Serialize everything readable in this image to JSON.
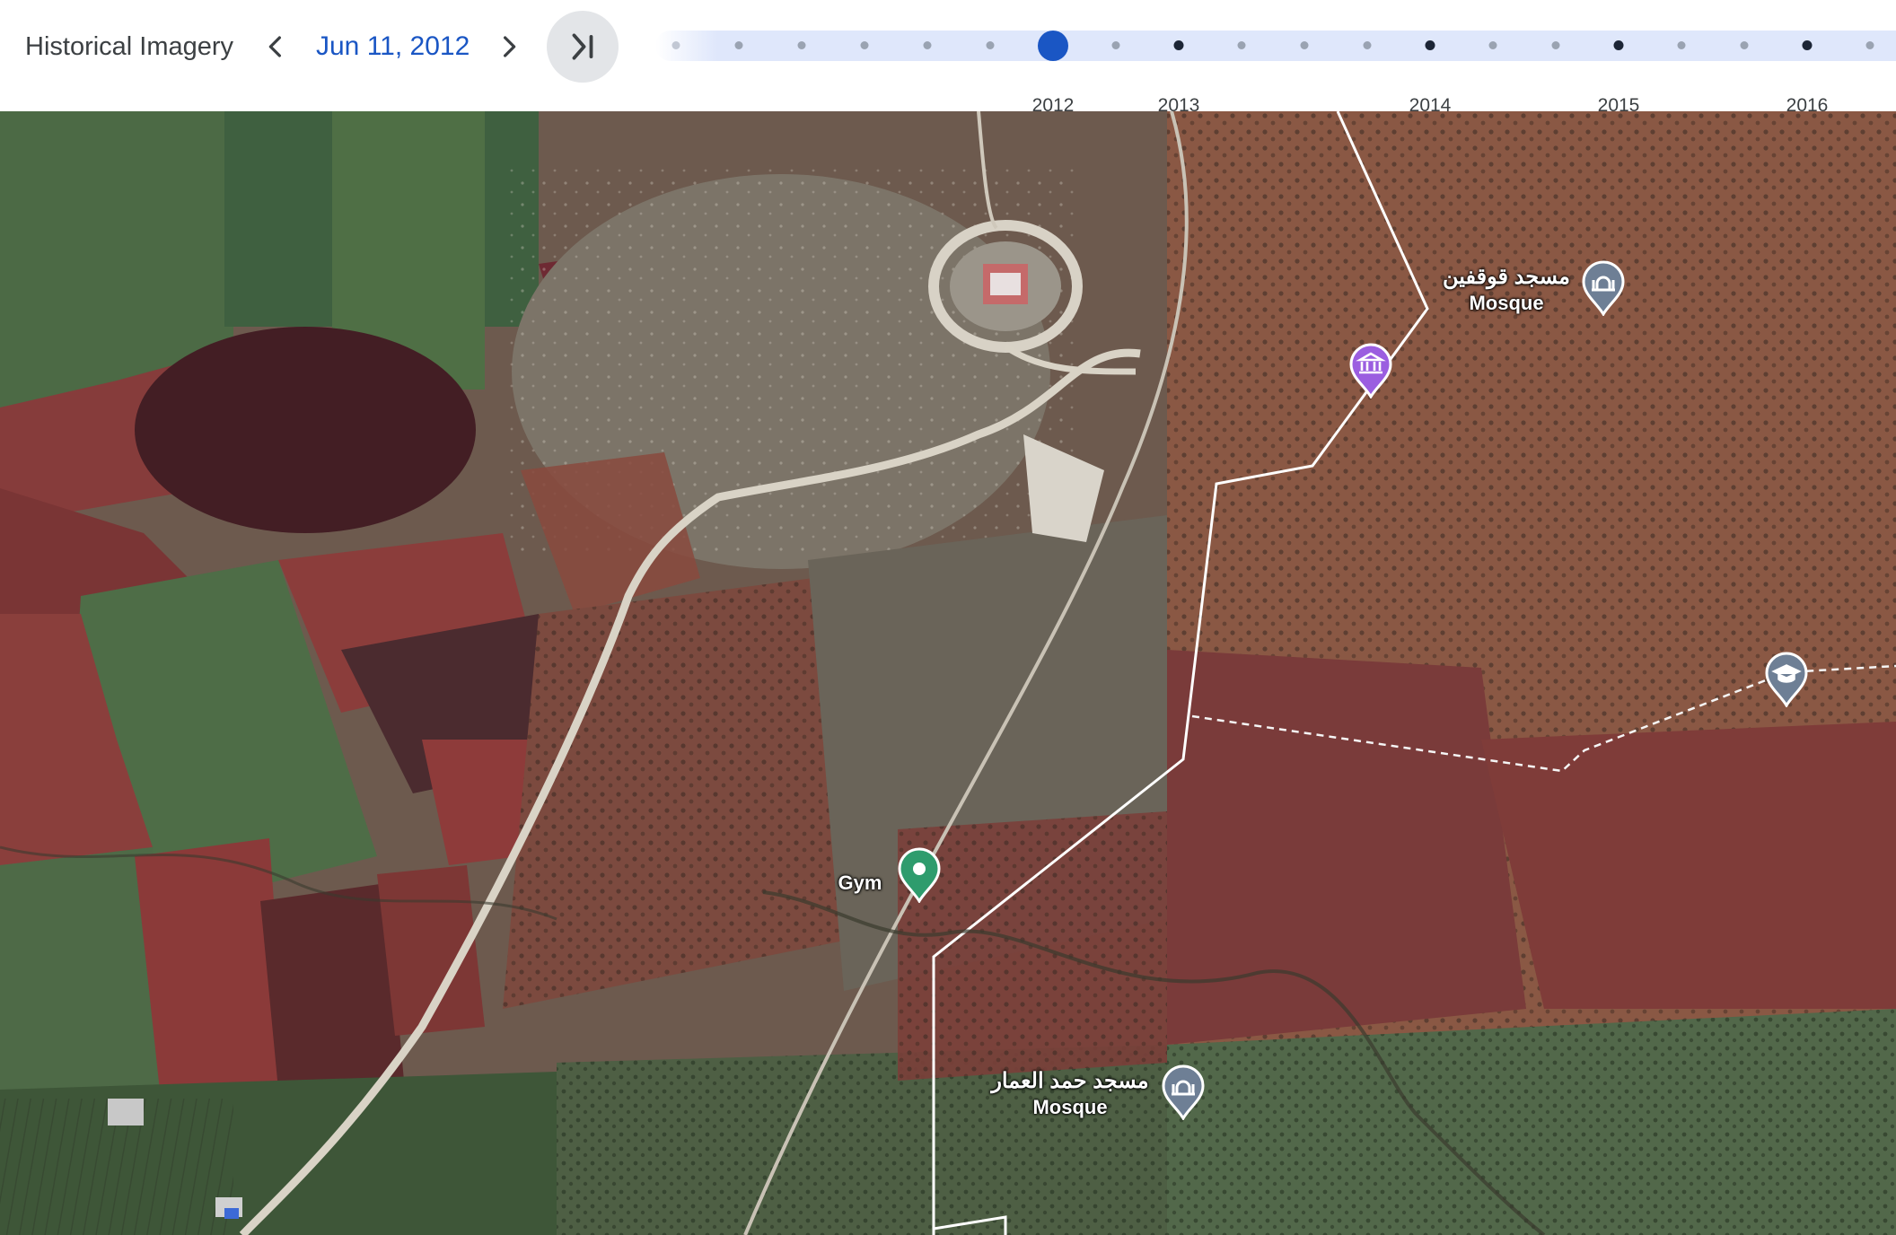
{
  "header": {
    "title": "Historical Imagery",
    "date": "Jun 11, 2012"
  },
  "icons": {
    "prev": "chevron-left-icon",
    "next": "chevron-right-icon",
    "latest": "skip-to-latest-icon",
    "mosque_pin": "mosque-pin-icon",
    "museum_pin": "museum-pin-icon",
    "school_pin": "school-pin-icon",
    "gym_pin": "place-pin-icon"
  },
  "timeline": {
    "years": [
      "2012",
      "2013",
      "2014",
      "2015",
      "2016"
    ],
    "current_year": "2012"
  },
  "places": {
    "mosque_north": {
      "name": "مسجد قوقفين",
      "category": "Mosque"
    },
    "mosque_south": {
      "name": "مسجد حمد العمار",
      "category": "Mosque"
    },
    "gym": {
      "name": "Gym"
    }
  },
  "colors": {
    "accent": "#1a56c4",
    "mosque_pin": "#6e7f95",
    "museum_pin": "#9b5ee0",
    "gym_pin": "#2e9c6d",
    "school_pin": "#6e7f95"
  }
}
